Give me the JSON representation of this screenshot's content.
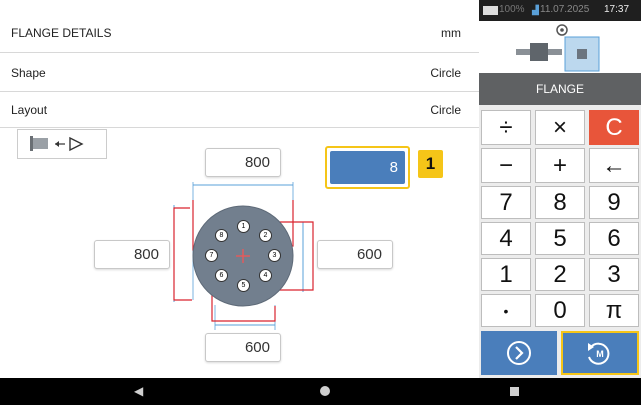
{
  "header": {
    "title": "FLANGE DETAILS",
    "unit": "mm"
  },
  "rows": [
    {
      "label": "Shape",
      "value": "Circle"
    },
    {
      "label": "Layout",
      "value": "Circle"
    }
  ],
  "diagram": {
    "top_value": "800",
    "left_value": "800",
    "right_value": "600",
    "bottom_value": "600",
    "bolt_count": "8",
    "callout": "1",
    "bolt_numbers": [
      "1",
      "2",
      "3",
      "4",
      "5",
      "6",
      "7",
      "8"
    ]
  },
  "status_bar": {
    "battery": "100%",
    "datetime": "11.07.2025",
    "time": "17:37"
  },
  "panel": {
    "title": "FLANGE"
  },
  "keypad": [
    [
      "÷",
      "×",
      "C"
    ],
    [
      "−",
      "+",
      "←"
    ],
    [
      "7",
      "8",
      "9"
    ],
    [
      "4",
      "5",
      "6"
    ],
    [
      "1",
      "2",
      "3"
    ],
    [
      "•",
      "0",
      "π"
    ]
  ],
  "colors": {
    "accent": "#4a7ebb",
    "highlight": "#f5c518",
    "clear": "#e8553a",
    "panel_dark": "#5f6163"
  }
}
